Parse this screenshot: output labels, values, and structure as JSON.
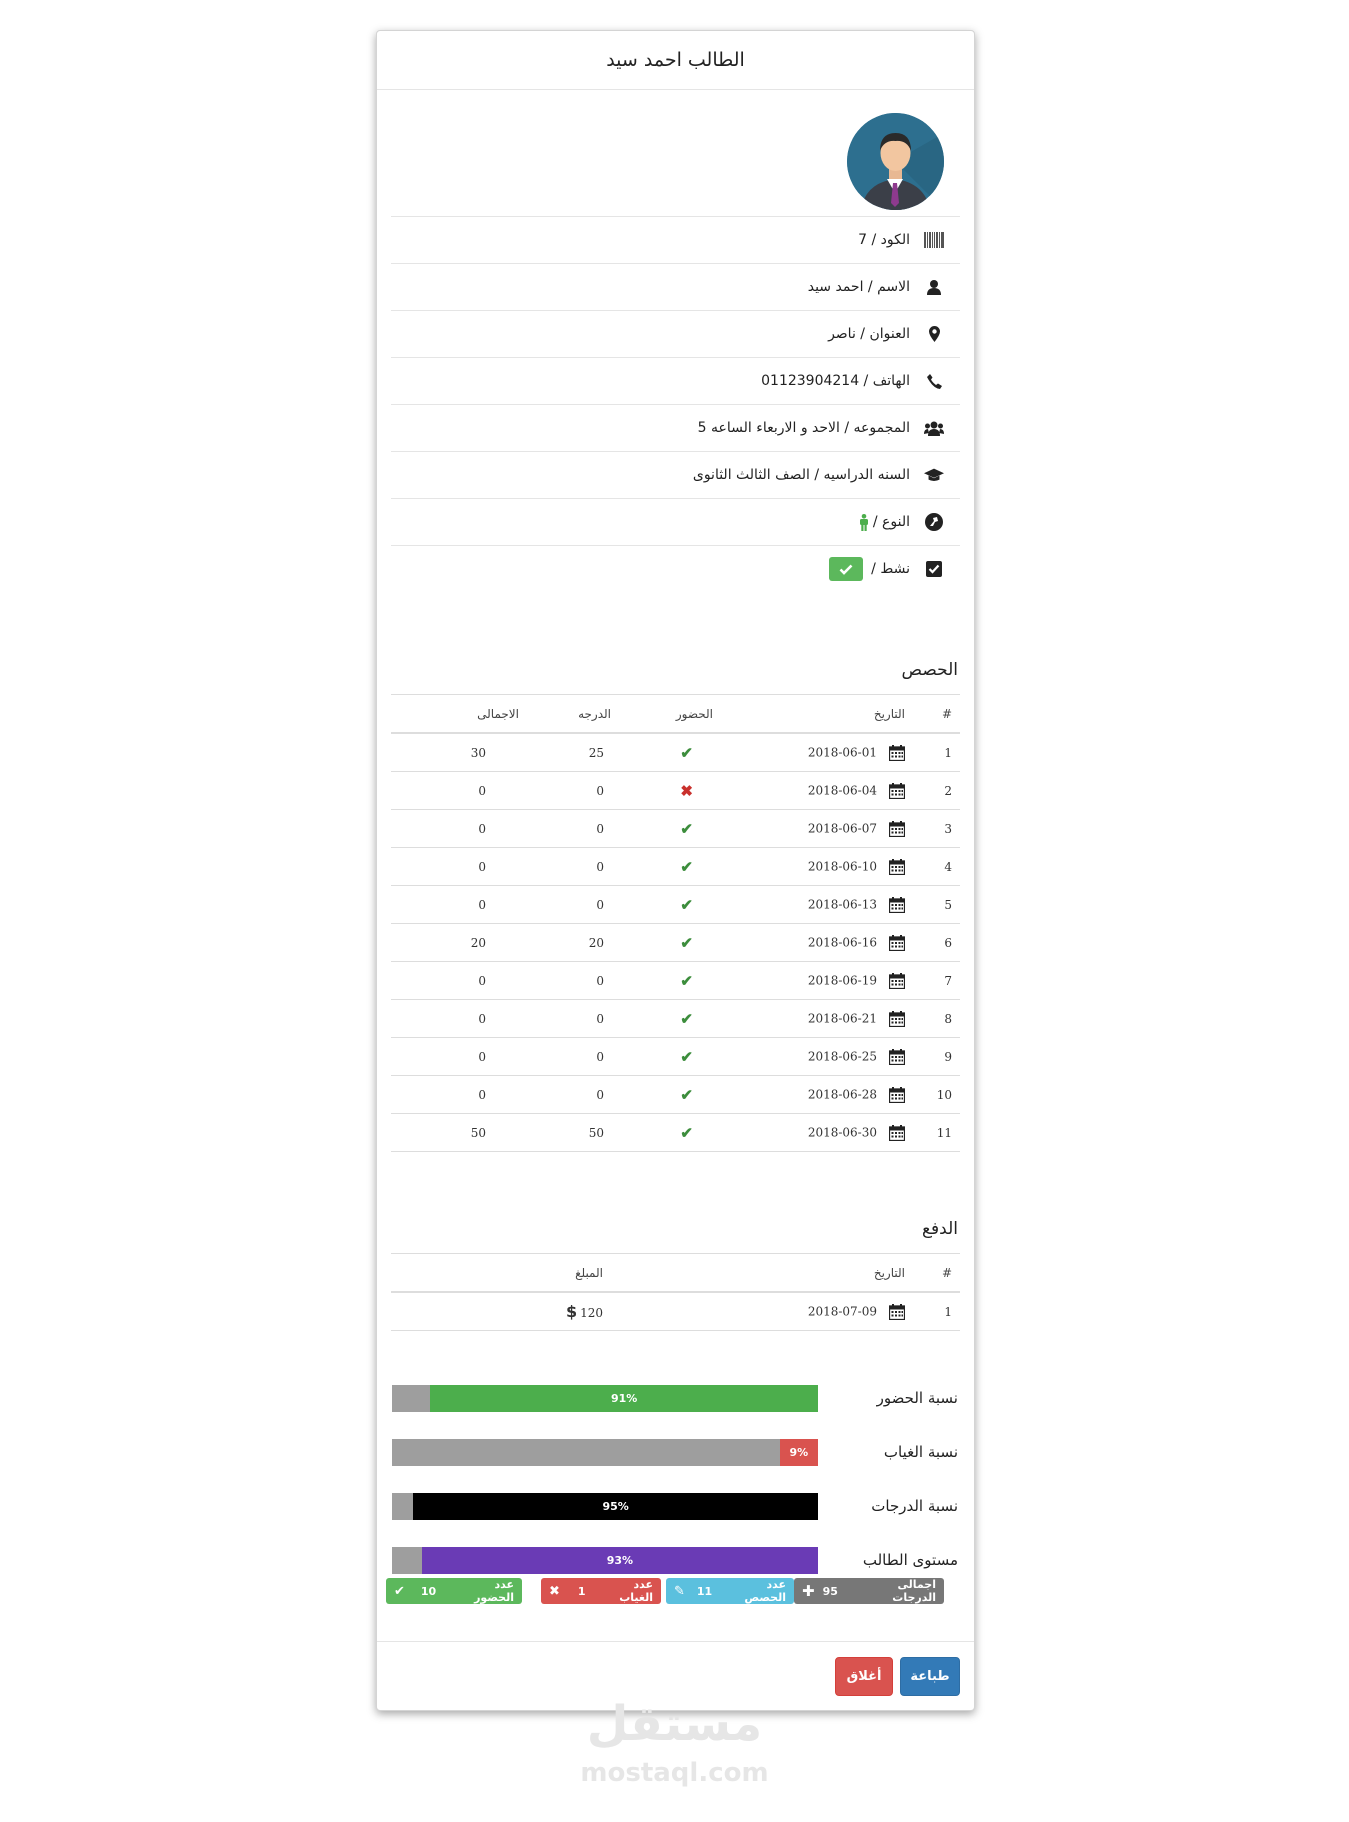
{
  "title": "الطالب احمد سيد",
  "info": {
    "code": "الكود / 7",
    "name": "الاسم / احمد سيد",
    "address": "العنوان / ناصر",
    "phone": "الهاتف / 01123904214",
    "group": "المجموعه / الاحد و الاربعاء الساعه 5",
    "year": "السنه الدراسيه / الصف الثالث الثانوى",
    "gender": "النوع /",
    "active": "نشط /"
  },
  "sessions": {
    "heading": "الحصص",
    "headers": [
      "#",
      "التاريخ",
      "الحضور",
      "الدرجه",
      "الاجمالى"
    ],
    "rows": [
      {
        "n": "1",
        "date": "2018-06-01",
        "present": true,
        "grade": "25",
        "total": "30"
      },
      {
        "n": "2",
        "date": "2018-06-04",
        "present": false,
        "grade": "0",
        "total": "0"
      },
      {
        "n": "3",
        "date": "2018-06-07",
        "present": true,
        "grade": "0",
        "total": "0"
      },
      {
        "n": "4",
        "date": "2018-06-10",
        "present": true,
        "grade": "0",
        "total": "0"
      },
      {
        "n": "5",
        "date": "2018-06-13",
        "present": true,
        "grade": "0",
        "total": "0"
      },
      {
        "n": "6",
        "date": "2018-06-16",
        "present": true,
        "grade": "20",
        "total": "20"
      },
      {
        "n": "7",
        "date": "2018-06-19",
        "present": true,
        "grade": "0",
        "total": "0"
      },
      {
        "n": "8",
        "date": "2018-06-21",
        "present": true,
        "grade": "0",
        "total": "0"
      },
      {
        "n": "9",
        "date": "2018-06-25",
        "present": true,
        "grade": "0",
        "total": "0"
      },
      {
        "n": "10",
        "date": "2018-06-28",
        "present": true,
        "grade": "0",
        "total": "0"
      },
      {
        "n": "11",
        "date": "2018-06-30",
        "present": true,
        "grade": "50",
        "total": "50"
      }
    ]
  },
  "payments": {
    "heading": "الدفع",
    "headers": [
      "#",
      "التاريخ",
      "المبلغ"
    ],
    "rows": [
      {
        "n": "1",
        "date": "2018-07-09",
        "amount": "120"
      }
    ]
  },
  "progress": [
    {
      "label": "نسبة الحضور",
      "value": 91,
      "text": "91%",
      "color": "#4cae4c"
    },
    {
      "label": "نسبة الغياب",
      "value": 9,
      "text": "9%",
      "color": "#d9534f"
    },
    {
      "label": "نسبة الدرجات",
      "value": 95,
      "text": "95%",
      "color": "#000000"
    },
    {
      "label": "مستوى الطالب",
      "value": 93,
      "text": "93%",
      "color": "#6a3bb5"
    }
  ],
  "stats": {
    "total_grades_label": "اجمالى الدرجات",
    "total_grades_value": "95",
    "sessions_label": "عدد الحصص",
    "sessions_value": "11",
    "absence_label": "عدد الغياب",
    "absence_value": "1",
    "attendance_label": "عدد الحضور",
    "attendance_value": "10"
  },
  "buttons": {
    "print": "طباعة",
    "close": "أغلاق"
  },
  "watermark": {
    "arabic": "مستقل",
    "latin": "mostaql.com"
  },
  "colors": {
    "primary": "#337ab7",
    "danger": "#d9534f",
    "success": "#5cb85c",
    "info": "#5bc0de",
    "default": "#777777"
  }
}
